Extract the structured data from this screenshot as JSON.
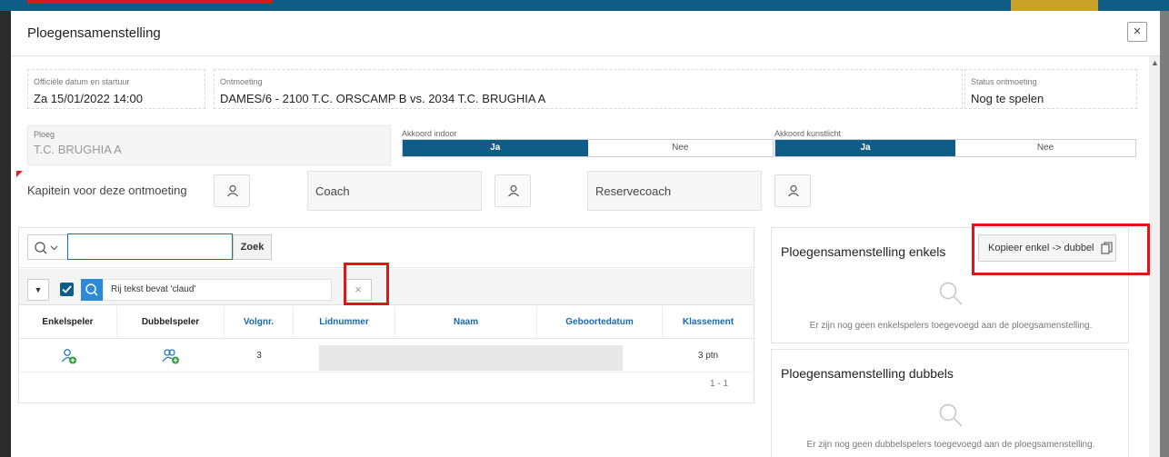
{
  "dialog": {
    "title": "Ploegensamenstelling",
    "close_symbol": "×"
  },
  "fields": {
    "datum": {
      "label": "Officiële datum en startuur",
      "value": "Za 15/01/2022 14:00"
    },
    "ontmoeting": {
      "label": "Ontmoeting",
      "value": "DAMES/6 - 2100 T.C. ORSCAMP B vs. 2034 T.C. BRUGHIA A"
    },
    "status": {
      "label": "Status ontmoeting",
      "value": "Nog te spelen"
    },
    "ploeg": {
      "label": "Ploeg",
      "value": "T.C. BRUGHIA A"
    }
  },
  "akkoord_indoor": {
    "label": "Akkoord indoor",
    "yes": "Ja",
    "no": "Nee",
    "selected": "Ja"
  },
  "akkoord_kunstlicht": {
    "label": "Akkoord kunstlicht",
    "yes": "Ja",
    "no": "Nee",
    "selected": "Ja"
  },
  "roles": {
    "kapitein": "Kapitein voor deze ontmoeting",
    "coach": "Coach",
    "reservecoach": "Reservecoach"
  },
  "grid": {
    "search_value": "",
    "search_button": "Zoek",
    "filter_text": "Rij tekst bevat 'claud'",
    "filter_remove_symbol": "×",
    "columns": [
      "Enkelspeler",
      "Dubbelspeler",
      "Volgnr.",
      "Lidnummer",
      "Naam",
      "Geboortedatum",
      "Klassement"
    ],
    "rows": [
      {
        "volgnr": "3",
        "lidnummer": "",
        "naam": "",
        "geboortedatum": "",
        "klassement": "3 ptn"
      }
    ],
    "pagination": "1 - 1"
  },
  "enkels": {
    "title": "Ploegensamenstelling enkels",
    "copy_button": "Kopieer enkel -> dubbel",
    "empty": "Er zijn nog geen enkelspelers toegevoegd aan de ploegsamenstelling."
  },
  "dubbels": {
    "title": "Ploegensamenstelling dubbels",
    "empty": "Er zijn nog geen dubbelspelers toegevoegd aan de ploegsamenstelling."
  },
  "colors": {
    "primary": "#0f5c86",
    "accent_blue": "#2c8ad8",
    "highlight_red": "#e01515",
    "add_green": "#2e9e3e"
  }
}
